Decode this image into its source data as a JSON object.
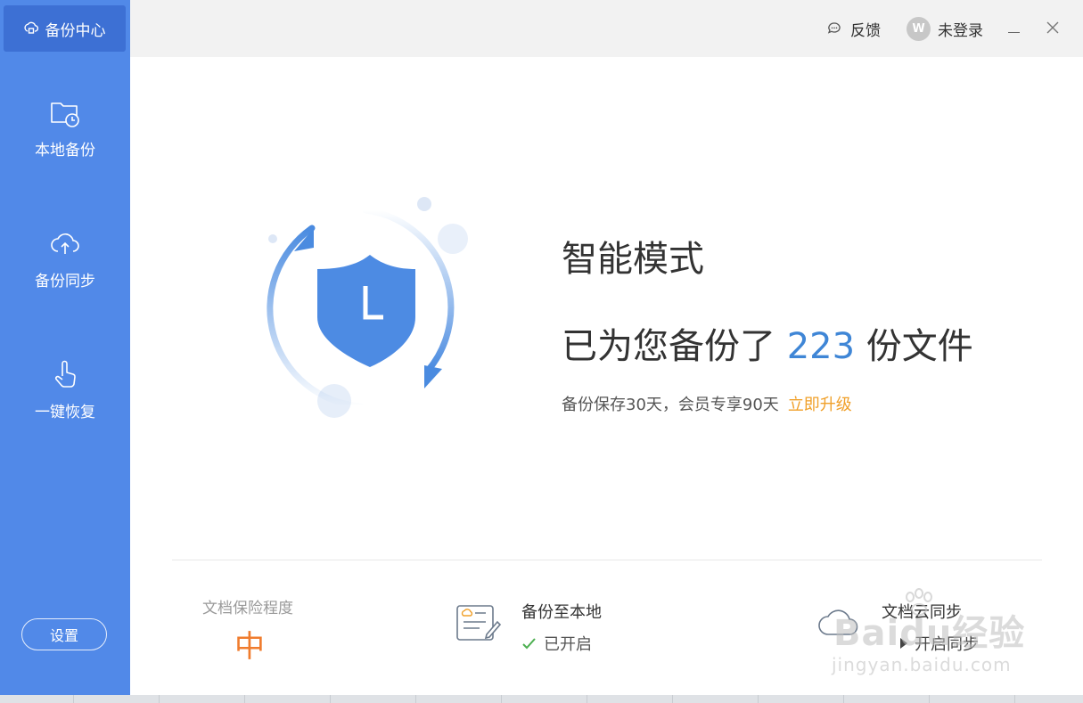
{
  "sidebar": {
    "brand_label": "备份中心",
    "brand_icon": "backup-center-icon",
    "items": [
      {
        "label": "本地备份",
        "icon": "folder-clock-icon"
      },
      {
        "label": "备份同步",
        "icon": "cloud-upload-icon"
      },
      {
        "label": "一键恢复",
        "icon": "hand-pointer-icon"
      }
    ],
    "settings_label": "设置"
  },
  "header": {
    "feedback_label": "反馈",
    "login_label": "未登录",
    "avatar_letter": "W"
  },
  "main": {
    "mode_title": "智能模式",
    "backup_count_prefix": "已为您备份了",
    "backup_count": "223",
    "backup_count_suffix": "份文件",
    "retention_text": "备份保存30天，会员专享90天",
    "upgrade_link": "立即升级"
  },
  "status": {
    "protection_label": "文档保险程度",
    "protection_level": "中",
    "local_title": "备份至本地",
    "local_status": "已开启",
    "cloud_title": "文档云同步",
    "cloud_action": "开启同步"
  },
  "watermark": {
    "brand": "Baidu经验",
    "url": "jingyan.baidu.com"
  },
  "colors": {
    "sidebar": "#5189e8",
    "sidebar_active": "#3d70d4",
    "accent_blue": "#3f86d6",
    "upgrade_orange": "#f0a02a",
    "level_orange": "#f07c2e",
    "check_green": "#4caf50"
  }
}
